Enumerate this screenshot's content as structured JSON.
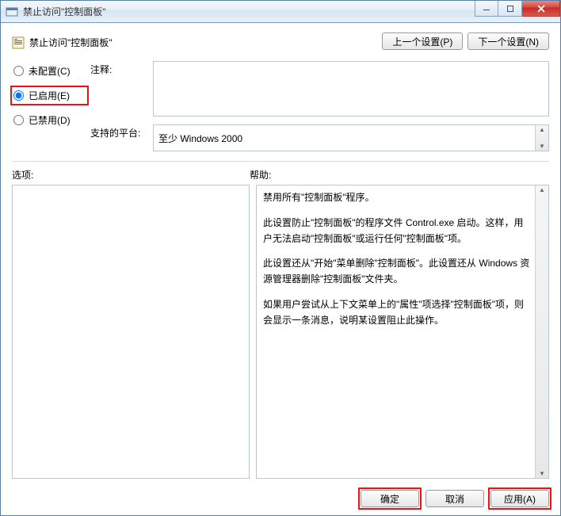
{
  "window": {
    "title": "禁止访问\"控制面板\""
  },
  "header": {
    "page_title": "禁止访问\"控制面板\""
  },
  "nav": {
    "prev": "上一个设置(P)",
    "next": "下一个设置(N)"
  },
  "state_radios": {
    "not_configured": "未配置(C)",
    "enabled": "已启用(E)",
    "disabled": "已禁用(D)",
    "selected": "enabled"
  },
  "fields": {
    "comment_label": "注释:",
    "comment_value": "",
    "platform_label": "支持的平台:",
    "platform_value": "至少 Windows 2000"
  },
  "sections": {
    "options_label": "选项:",
    "help_label": "帮助:"
  },
  "help": {
    "p1": "禁用所有\"控制面板\"程序。",
    "p2": "此设置防止\"控制面板\"的程序文件 Control.exe 启动。这样，用户无法启动\"控制面板\"或运行任何\"控制面板\"项。",
    "p3": "此设置还从\"开始\"菜单删除\"控制面板\"。此设置还从 Windows 资源管理器删除\"控制面板\"文件夹。",
    "p4": "如果用户尝试从上下文菜单上的\"属性\"项选择\"控制面板\"项，则会显示一条消息，说明某设置阻止此操作。"
  },
  "buttons": {
    "ok": "确定",
    "cancel": "取消",
    "apply": "应用(A)"
  }
}
